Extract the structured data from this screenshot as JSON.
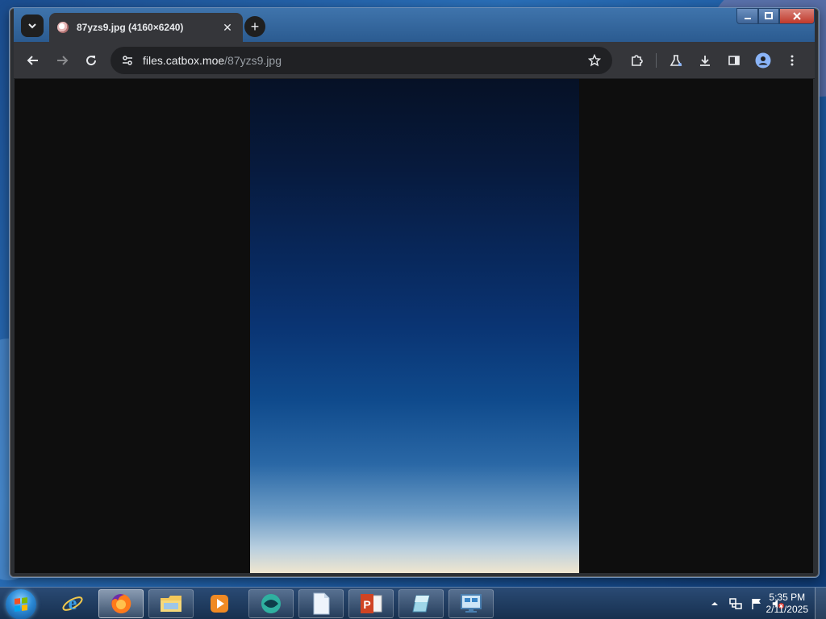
{
  "browser": {
    "tab": {
      "title": "87yzs9.jpg (4160×6240)"
    },
    "omnibox": {
      "host": "files.catbox.moe",
      "path": "/87yzs9.jpg"
    }
  },
  "taskbar": {
    "apps": [
      {
        "name": "Internet Explorer",
        "icon": "internet-explorer-icon"
      },
      {
        "name": "Firefox",
        "icon": "firefox-icon"
      },
      {
        "name": "File Explorer",
        "icon": "folder-icon"
      },
      {
        "name": "Media Player",
        "icon": "media-player-icon"
      },
      {
        "name": "App",
        "icon": "round-app-icon"
      },
      {
        "name": "Blank document",
        "icon": "document-icon"
      },
      {
        "name": "PowerPoint",
        "icon": "powerpoint-icon"
      },
      {
        "name": "Notes",
        "icon": "notes-icon"
      },
      {
        "name": "Remote Desktop",
        "icon": "remote-desktop-icon"
      }
    ],
    "clock": {
      "time": "5:35 PM",
      "date": "2/11/2025"
    }
  },
  "colors": {
    "tab_active": "#35363a",
    "toolbar": "#35363a",
    "omnibox": "#202124",
    "page_bg": "#0e0e0e"
  }
}
